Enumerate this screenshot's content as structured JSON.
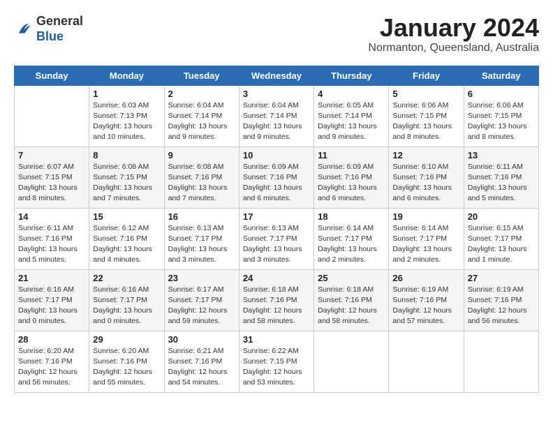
{
  "header": {
    "logo_general": "General",
    "logo_blue": "Blue",
    "month_title": "January 2024",
    "location": "Normanton, Queensland, Australia"
  },
  "weekdays": [
    "Sunday",
    "Monday",
    "Tuesday",
    "Wednesday",
    "Thursday",
    "Friday",
    "Saturday"
  ],
  "weeks": [
    [
      {
        "num": "",
        "info": ""
      },
      {
        "num": "1",
        "info": "Sunrise: 6:03 AM\nSunset: 7:13 PM\nDaylight: 13 hours\nand 10 minutes."
      },
      {
        "num": "2",
        "info": "Sunrise: 6:04 AM\nSunset: 7:14 PM\nDaylight: 13 hours\nand 9 minutes."
      },
      {
        "num": "3",
        "info": "Sunrise: 6:04 AM\nSunset: 7:14 PM\nDaylight: 13 hours\nand 9 minutes."
      },
      {
        "num": "4",
        "info": "Sunrise: 6:05 AM\nSunset: 7:14 PM\nDaylight: 13 hours\nand 9 minutes."
      },
      {
        "num": "5",
        "info": "Sunrise: 6:06 AM\nSunset: 7:15 PM\nDaylight: 13 hours\nand 8 minutes."
      },
      {
        "num": "6",
        "info": "Sunrise: 6:06 AM\nSunset: 7:15 PM\nDaylight: 13 hours\nand 8 minutes."
      }
    ],
    [
      {
        "num": "7",
        "info": "Sunrise: 6:07 AM\nSunset: 7:15 PM\nDaylight: 13 hours\nand 8 minutes."
      },
      {
        "num": "8",
        "info": "Sunrise: 6:08 AM\nSunset: 7:15 PM\nDaylight: 13 hours\nand 7 minutes."
      },
      {
        "num": "9",
        "info": "Sunrise: 6:08 AM\nSunset: 7:16 PM\nDaylight: 13 hours\nand 7 minutes."
      },
      {
        "num": "10",
        "info": "Sunrise: 6:09 AM\nSunset: 7:16 PM\nDaylight: 13 hours\nand 6 minutes."
      },
      {
        "num": "11",
        "info": "Sunrise: 6:09 AM\nSunset: 7:16 PM\nDaylight: 13 hours\nand 6 minutes."
      },
      {
        "num": "12",
        "info": "Sunrise: 6:10 AM\nSunset: 7:16 PM\nDaylight: 13 hours\nand 6 minutes."
      },
      {
        "num": "13",
        "info": "Sunrise: 6:11 AM\nSunset: 7:16 PM\nDaylight: 13 hours\nand 5 minutes."
      }
    ],
    [
      {
        "num": "14",
        "info": "Sunrise: 6:11 AM\nSunset: 7:16 PM\nDaylight: 13 hours\nand 5 minutes."
      },
      {
        "num": "15",
        "info": "Sunrise: 6:12 AM\nSunset: 7:16 PM\nDaylight: 13 hours\nand 4 minutes."
      },
      {
        "num": "16",
        "info": "Sunrise: 6:13 AM\nSunset: 7:17 PM\nDaylight: 13 hours\nand 3 minutes."
      },
      {
        "num": "17",
        "info": "Sunrise: 6:13 AM\nSunset: 7:17 PM\nDaylight: 13 hours\nand 3 minutes."
      },
      {
        "num": "18",
        "info": "Sunrise: 6:14 AM\nSunset: 7:17 PM\nDaylight: 13 hours\nand 2 minutes."
      },
      {
        "num": "19",
        "info": "Sunrise: 6:14 AM\nSunset: 7:17 PM\nDaylight: 13 hours\nand 2 minutes."
      },
      {
        "num": "20",
        "info": "Sunrise: 6:15 AM\nSunset: 7:17 PM\nDaylight: 13 hours\nand 1 minute."
      }
    ],
    [
      {
        "num": "21",
        "info": "Sunrise: 6:16 AM\nSunset: 7:17 PM\nDaylight: 13 hours\nand 0 minutes."
      },
      {
        "num": "22",
        "info": "Sunrise: 6:16 AM\nSunset: 7:17 PM\nDaylight: 13 hours\nand 0 minutes."
      },
      {
        "num": "23",
        "info": "Sunrise: 6:17 AM\nSunset: 7:17 PM\nDaylight: 12 hours\nand 59 minutes."
      },
      {
        "num": "24",
        "info": "Sunrise: 6:18 AM\nSunset: 7:16 PM\nDaylight: 12 hours\nand 58 minutes."
      },
      {
        "num": "25",
        "info": "Sunrise: 6:18 AM\nSunset: 7:16 PM\nDaylight: 12 hours\nand 58 minutes."
      },
      {
        "num": "26",
        "info": "Sunrise: 6:19 AM\nSunset: 7:16 PM\nDaylight: 12 hours\nand 57 minutes."
      },
      {
        "num": "27",
        "info": "Sunrise: 6:19 AM\nSunset: 7:16 PM\nDaylight: 12 hours\nand 56 minutes."
      }
    ],
    [
      {
        "num": "28",
        "info": "Sunrise: 6:20 AM\nSunset: 7:16 PM\nDaylight: 12 hours\nand 56 minutes."
      },
      {
        "num": "29",
        "info": "Sunrise: 6:20 AM\nSunset: 7:16 PM\nDaylight: 12 hours\nand 55 minutes."
      },
      {
        "num": "30",
        "info": "Sunrise: 6:21 AM\nSunset: 7:16 PM\nDaylight: 12 hours\nand 54 minutes."
      },
      {
        "num": "31",
        "info": "Sunrise: 6:22 AM\nSunset: 7:15 PM\nDaylight: 12 hours\nand 53 minutes."
      },
      {
        "num": "",
        "info": ""
      },
      {
        "num": "",
        "info": ""
      },
      {
        "num": "",
        "info": ""
      }
    ]
  ]
}
